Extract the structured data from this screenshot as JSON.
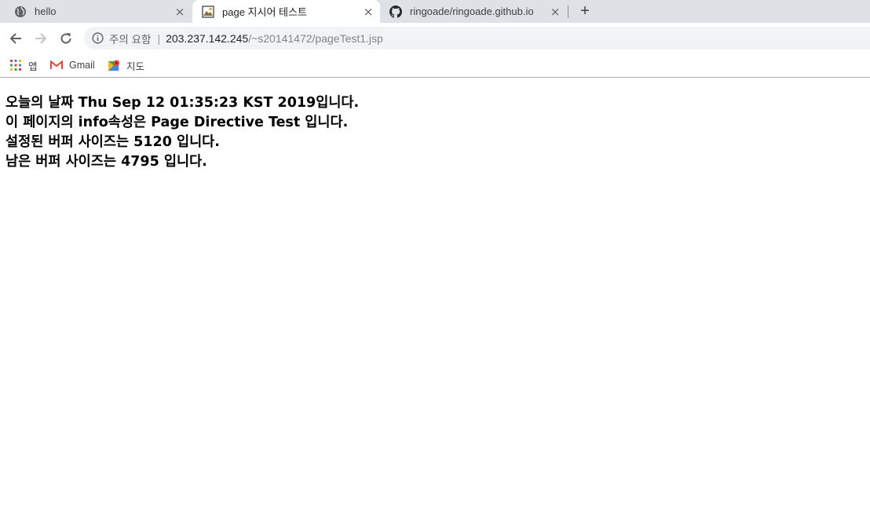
{
  "tabs": [
    {
      "title": "hello",
      "icon": "globe-icon",
      "active": false
    },
    {
      "title": "page 지시어 테스트",
      "icon": "page-favicon-icon",
      "active": true
    },
    {
      "title": "ringoade/ringoade.github.io",
      "icon": "github-icon",
      "active": false
    }
  ],
  "tab_close_glyph": "×",
  "new_tab_glyph": "+",
  "address_bar": {
    "security_label": "주의 요함",
    "divider": "|",
    "host": "203.237.142.245",
    "path": "/~s20141472/pageTest1.jsp"
  },
  "bookmarks": [
    {
      "label": "앱",
      "icon": "apps-grid-icon"
    },
    {
      "label": "Gmail",
      "icon": "gmail-icon"
    },
    {
      "label": "지도",
      "icon": "maps-icon"
    }
  ],
  "content": {
    "lines": [
      "오늘의 날짜 Thu Sep 12 01:35:23 KST 2019입니다.",
      "이 페이지의 info속성은 Page Directive Test 입니다.",
      "설정된 버퍼 사이즈는 5120 입니다.",
      "남은 버퍼 사이즈는 4795 입니다."
    ]
  },
  "colors": {
    "tabstrip_bg": "#dee1e6",
    "omnibox_bg": "#f1f3f4",
    "gmail_red": "#ea4335"
  }
}
